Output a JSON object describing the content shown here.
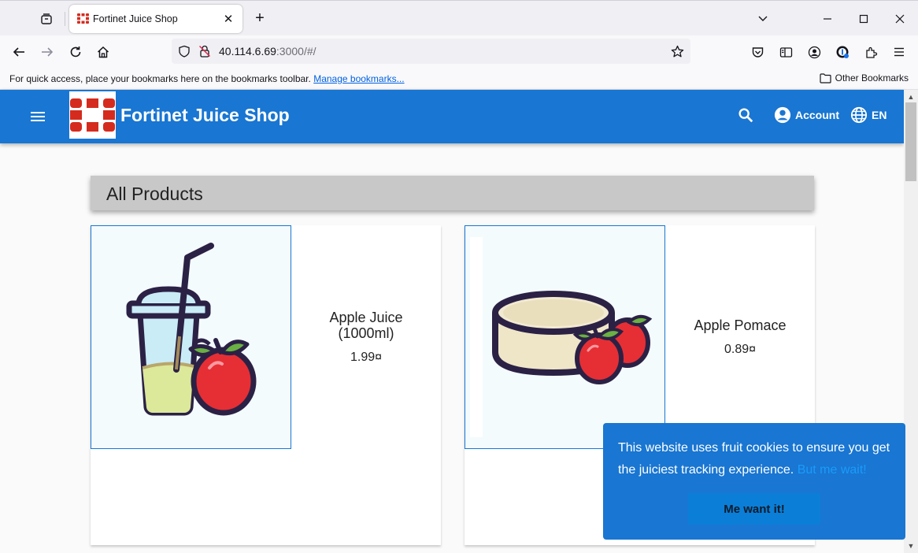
{
  "browser": {
    "tab_title": "Fortinet Juice Shop",
    "url_host": "40.114.6.69",
    "url_rest": ":3000/#/",
    "bookmarks_prompt": "For quick access, place your bookmarks here on the bookmarks toolbar.",
    "manage_bookmarks": "Manage bookmarks...",
    "other_bookmarks": "Other Bookmarks"
  },
  "app": {
    "title": "Fortinet Juice Shop",
    "account_label": "Account",
    "language_label": "EN",
    "brand_color": "#1976d2"
  },
  "main": {
    "heading": "All Products",
    "products": [
      {
        "name": "Apple Juice (1000ml)",
        "price": "1.99¤",
        "image_icon": "apple-juice-cup"
      },
      {
        "name": "Apple Pomace",
        "price": "0.89¤",
        "image_icon": "apple-pomace"
      }
    ]
  },
  "cookie_banner": {
    "message": "This website uses fruit cookies to ensure you get the juiciest tracking experience.",
    "link": "But me wait!",
    "button": "Me want it!"
  }
}
